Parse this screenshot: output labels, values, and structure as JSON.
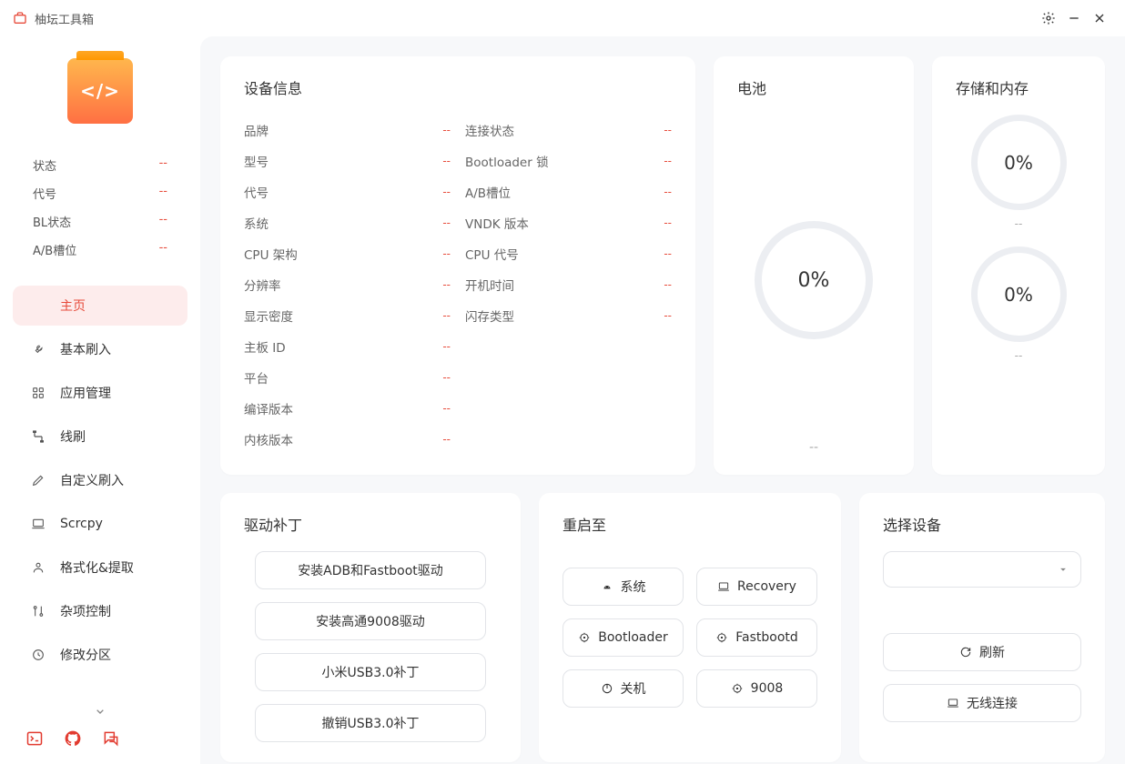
{
  "titlebar": {
    "title": "柚坛工具箱"
  },
  "sidebar": {
    "status": [
      {
        "label": "状态",
        "value": "--"
      },
      {
        "label": "代号",
        "value": "--"
      },
      {
        "label": "BL状态",
        "value": "--"
      },
      {
        "label": "A/B槽位",
        "value": "--"
      }
    ],
    "nav": [
      {
        "label": "主页",
        "icon": "home"
      },
      {
        "label": "基本刷入",
        "icon": "wrench"
      },
      {
        "label": "应用管理",
        "icon": "grid"
      },
      {
        "label": "线刷",
        "icon": "cable"
      },
      {
        "label": "自定义刷入",
        "icon": "edit"
      },
      {
        "label": "Scrcpy",
        "icon": "laptop"
      },
      {
        "label": "格式化&提取",
        "icon": "person"
      },
      {
        "label": "杂项控制",
        "icon": "sliders"
      },
      {
        "label": "修改分区",
        "icon": "clock"
      }
    ]
  },
  "deviceInfo": {
    "title": "设备信息",
    "left": [
      {
        "label": "品牌",
        "value": "--"
      },
      {
        "label": "型号",
        "value": "--"
      },
      {
        "label": "代号",
        "value": "--"
      },
      {
        "label": "系统",
        "value": "--"
      },
      {
        "label": "CPU 架构",
        "value": "--"
      },
      {
        "label": "分辨率",
        "value": "--"
      },
      {
        "label": "显示密度",
        "value": "--"
      },
      {
        "label": "主板 ID",
        "value": "--"
      },
      {
        "label": "平台",
        "value": "--"
      },
      {
        "label": "编译版本",
        "value": "--"
      },
      {
        "label": "内核版本",
        "value": "--"
      }
    ],
    "right": [
      {
        "label": "连接状态",
        "value": "--"
      },
      {
        "label": "Bootloader 锁",
        "value": "--"
      },
      {
        "label": "A/B槽位",
        "value": "--"
      },
      {
        "label": "VNDK 版本",
        "value": "--"
      },
      {
        "label": "CPU 代号",
        "value": "--"
      },
      {
        "label": "开机时间",
        "value": "--"
      },
      {
        "label": "闪存类型",
        "value": "--"
      }
    ]
  },
  "battery": {
    "title": "电池",
    "percent": "0%",
    "sub": "--"
  },
  "storage": {
    "title": "存储和内存",
    "ram": {
      "percent": "0%",
      "sub": "--"
    },
    "rom": {
      "percent": "0%",
      "sub": "--"
    }
  },
  "drivers": {
    "title": "驱动补丁",
    "items": [
      "安装ADB和Fastboot驱动",
      "安装高通9008驱动",
      "小米USB3.0补丁",
      "撤销USB3.0补丁"
    ]
  },
  "reboot": {
    "title": "重启至",
    "items": [
      {
        "label": "系统",
        "icon": "android"
      },
      {
        "label": "Recovery",
        "icon": "laptop"
      },
      {
        "label": "Bootloader",
        "icon": "target"
      },
      {
        "label": "Fastbootd",
        "icon": "target"
      },
      {
        "label": "关机",
        "icon": "power"
      },
      {
        "label": "9008",
        "icon": "target"
      }
    ]
  },
  "device": {
    "title": "选择设备",
    "refresh": "刷新",
    "wireless": "无线连接"
  }
}
